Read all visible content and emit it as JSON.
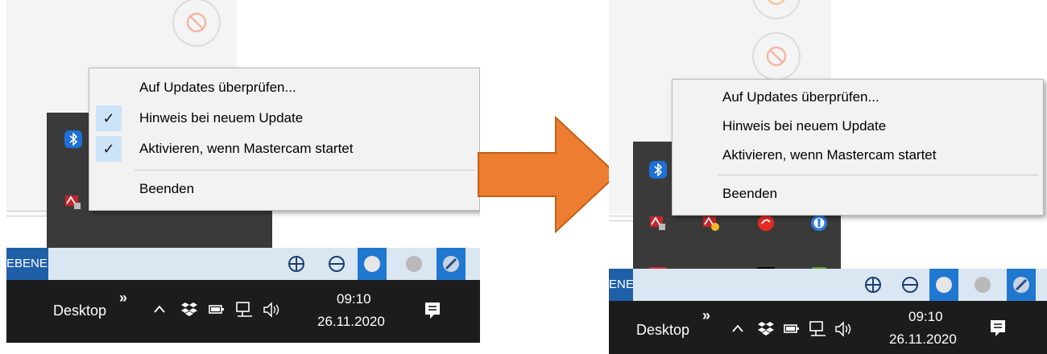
{
  "menu": {
    "items": [
      {
        "label": "Auf Updates überprüfen...",
        "checked": false
      },
      {
        "label": "Hinweis bei neuem Update",
        "checked": true
      },
      {
        "label": "Aktivieren, wenn Mastercam startet",
        "checked": true
      },
      {
        "label": "Beenden",
        "checked": false
      }
    ]
  },
  "menu_after": {
    "items": [
      {
        "label": "Auf Updates überprüfen...",
        "checked": false
      },
      {
        "label": "Hinweis bei neuem Update",
        "checked": false
      },
      {
        "label": "Aktivieren, wenn Mastercam startet",
        "checked": false
      },
      {
        "label": "Beenden",
        "checked": false
      }
    ]
  },
  "taskbar": {
    "desktop_label": "Desktop",
    "more_glyph": "»",
    "time": "09:10",
    "date": "26.11.2020"
  },
  "toolbar": {
    "partial_label_left": "EBENE",
    "partial_label_right": "ENE"
  },
  "colors": {
    "arrow": "#ed7d31",
    "taskbar": "#1c1c1c",
    "tray": "#3a3a3a",
    "menu": "#f2f2f2",
    "check_bg": "#cce4f7"
  },
  "icons": [
    "bluetooth-icon",
    "mastercam-tray-icon",
    "anydesk-icon",
    "red-puzzle-icon",
    "black-cube-icon",
    "green-check-icon",
    "red-swirl-icon",
    "onepassword-icon",
    "dropbox-icon",
    "battery-icon",
    "network-icon",
    "volume-icon",
    "notification-icon"
  ]
}
